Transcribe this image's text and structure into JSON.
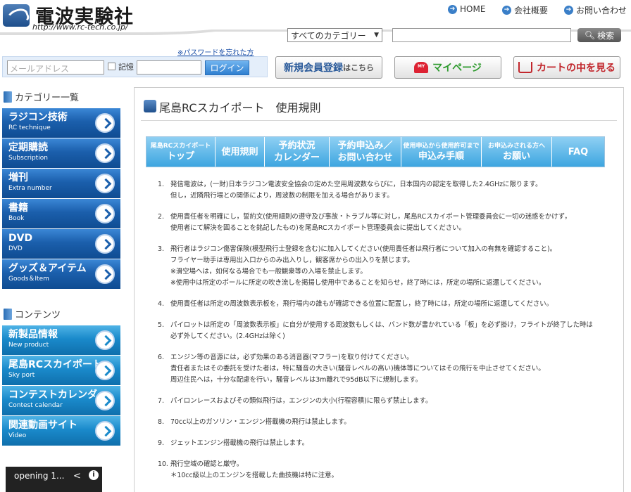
{
  "header": {
    "logo_text": "電波実験社",
    "logo_url": "http://www.rc-tech.co.jp/",
    "nav": [
      {
        "label": "HOME"
      },
      {
        "label": "会社概要"
      },
      {
        "label": "お問い合わせ"
      }
    ],
    "search": {
      "category_selected": "すべてのカテゴリー",
      "button_label": "検索"
    },
    "forgot_password": "※パスワードを忘れた方",
    "login": {
      "email_placeholder": "メールアドレス",
      "remember_label": "記憶",
      "button_label": "ログイン"
    },
    "buttons": {
      "register_main": "新規会員登録",
      "register_sub": "はこちら",
      "mypage_badge": "MY",
      "mypage": "マイページ",
      "cart": "カートの中を見る"
    }
  },
  "sidebar": {
    "category_title": "カテゴリー一覧",
    "categories": [
      {
        "jp": "ラジコン技術",
        "en": "RC technique"
      },
      {
        "jp": "定期購読",
        "en": "Subscription"
      },
      {
        "jp": "増刊",
        "en": "Extra number"
      },
      {
        "jp": "書籍",
        "en": "Book"
      },
      {
        "jp": "DVD",
        "en": "DVD"
      },
      {
        "jp": "グッズ＆アイテム",
        "en": "Goods＆Item"
      }
    ],
    "contents_title": "コンテンツ",
    "contents": [
      {
        "jp": "新製品情報",
        "en": "New product"
      },
      {
        "jp": "尾島RCスカイポート",
        "en": "Sky port"
      },
      {
        "jp": "コンテストカレンダー",
        "en": "Contest calendar"
      },
      {
        "jp": "関連動画サイト",
        "en": "Video"
      }
    ],
    "video_title": "opening 1..."
  },
  "main": {
    "title": "尾島RCスカイポート　使用規則",
    "tabs": [
      {
        "l1": "尾島RCスカイポート",
        "l2": "トップ"
      },
      {
        "l1": "",
        "l2": "使用規則"
      },
      {
        "l1": "予約状況",
        "l2": "カレンダー"
      },
      {
        "l1": "予約申込み／",
        "l2": "お問い合わせ"
      },
      {
        "l1": "使用申込から使用許可まで",
        "l2": "申込み手順"
      },
      {
        "l1": "お申込みされる方へ",
        "l2": "お願い"
      },
      {
        "l1": "",
        "l2": "FAQ"
      }
    ],
    "rules": [
      {
        "num": "1.",
        "lines": [
          "発信電波は，(一財)日本ラジコン電波安全協会の定めた空用周波数ならびに，日本国内の認定を取得した2.4GHzに限ります。",
          "但し，近隣飛行場との関係により，周波数の制限を加える場合があります。"
        ]
      },
      {
        "num": "2.",
        "lines": [
          "使用責任者を明確にし，誓約文(使用細則の遵守及び事故・トラブル等に対し，尾島RCスカイポート管理委員会に一切の迷惑をかけず，",
          "使用者にて解決を図ることを銘記したもの)を尾島RCスカイポート管理委員会に提出してください。"
        ]
      },
      {
        "num": "3.",
        "lines": [
          "飛行者はラジコン傷害保険(模型飛行士登録を含む)に加入してください(使用責任者は飛行者について加入の有無を確認すること)。",
          "フライヤー助手は専用出入口からのみ出入りし，観客席からの出入りを禁じます。",
          "※滑空場へは，如何なる場合でも一般観衆等の入場を禁止します。",
          "※使用中は所定のポールに所定の吹き流しを掲揚し使用中であることを知らせ，終了時には，所定の場所に返還してください。"
        ]
      },
      {
        "num": "4.",
        "lines": [
          "使用責任者は所定の周波数表示板を，飛行場内の誰もが確認できる位置に配置し，終了時には，所定の場所に返還してください。"
        ]
      },
      {
        "num": "5.",
        "lines": [
          "パイロットは所定の「周波数表示板」に自分が使用する周波数もしくは、バンド数が書かれている「板」を必ず掛け，フライトが終了した時は",
          "必ず外してください。(2.4GHzは除く)"
        ]
      },
      {
        "num": "6.",
        "lines": [
          "エンジン等の音源には，必ず効果のある消音器(マフラー)を取り付けてください。",
          "責任者またはその委託を受けた者は，特に騒音の大きい(騒音レベルの高い)機体等についてはその飛行を中止させてください。",
          "周辺住民へは，十分な配慮を行い，騒音レベルは3m離れで95dB以下に規制します。"
        ]
      },
      {
        "num": "7.",
        "lines": [
          "パイロンレースおよびその類似飛行は，エンジンの大小(行程容積)に限らず禁止します。"
        ]
      },
      {
        "num": "8.",
        "lines": [
          "70cc以上のガソリン・エンジン搭載機の飛行は禁止します。"
        ]
      },
      {
        "num": "9.",
        "lines": [
          "ジェットエンジン搭載機の飛行は禁止します。"
        ]
      },
      {
        "num": "10.",
        "lines": [
          "飛行空域の確認と厳守。",
          "＊10cc級以上のエンジンを搭載した曲技機は特に注意。"
        ]
      }
    ]
  },
  "colors": {
    "category_menu": "#1b5fac",
    "contents_menu": "#1a8acb",
    "tab": "#3da6e0",
    "login_button": "#2f7fd0"
  }
}
